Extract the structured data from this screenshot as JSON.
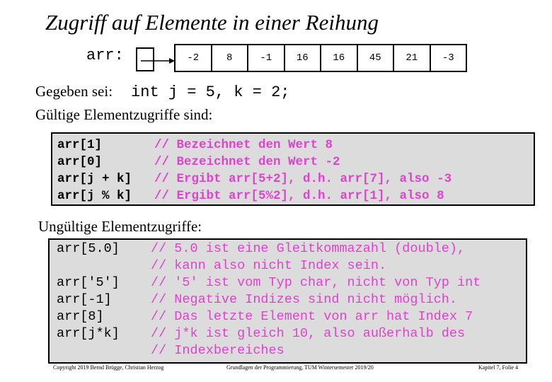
{
  "title": "Zugriff auf Elemente in einer Reihung",
  "array": {
    "label": "arr:",
    "values": [
      "-2",
      "8",
      "-1",
      "16",
      "16",
      "45",
      "21",
      "-3"
    ]
  },
  "given": {
    "label": "Gegeben sei:",
    "code": "int j = 5, k = 2;"
  },
  "valid_heading": "Gültige Elementzugriffe sind:",
  "valid": [
    {
      "expr": "arr[1]",
      "comment": "// Bezeichnet den Wert 8"
    },
    {
      "expr": "arr[0]",
      "comment": "// Bezeichnet den Wert -2"
    },
    {
      "expr": "arr[j + k]",
      "comment": "// Ergibt arr[5+2], d.h. arr[7], also -3"
    },
    {
      "expr": "arr[j % k]",
      "comment": "// Ergibt arr[5%2], d.h. arr[1], also 8"
    }
  ],
  "invalid_heading": "Ungültige Elementzugriffe:",
  "invalid": [
    {
      "expr": "arr[5.0]",
      "comment": "// 5.0 ist eine Gleitkommazahl (double),"
    },
    {
      "expr": "",
      "comment": "// kann also nicht Index sein."
    },
    {
      "expr": "arr['5']",
      "comment": "// '5' ist vom Typ char, nicht von Typ int"
    },
    {
      "expr": "arr[-1]",
      "comment": "// Negative Indizes sind nicht möglich."
    },
    {
      "expr": "arr[8]",
      "comment": "// Das letzte Element von arr hat Index 7"
    },
    {
      "expr": "arr[j*k]",
      "comment": "// j*k ist gleich 10, also außerhalb des"
    },
    {
      "expr": "",
      "comment": "// Indexbereiches"
    }
  ],
  "footer": {
    "left": "Copyright 2019 Bernd Brügge, Christian Herzog",
    "center": "Grundlagen der Programmierung, TUM Wintersemester 2019/20",
    "right": "Kapitel 7, Folie 4"
  },
  "colors": {
    "comment": "#dd44cc",
    "code_bg": "#dcdcdc"
  }
}
